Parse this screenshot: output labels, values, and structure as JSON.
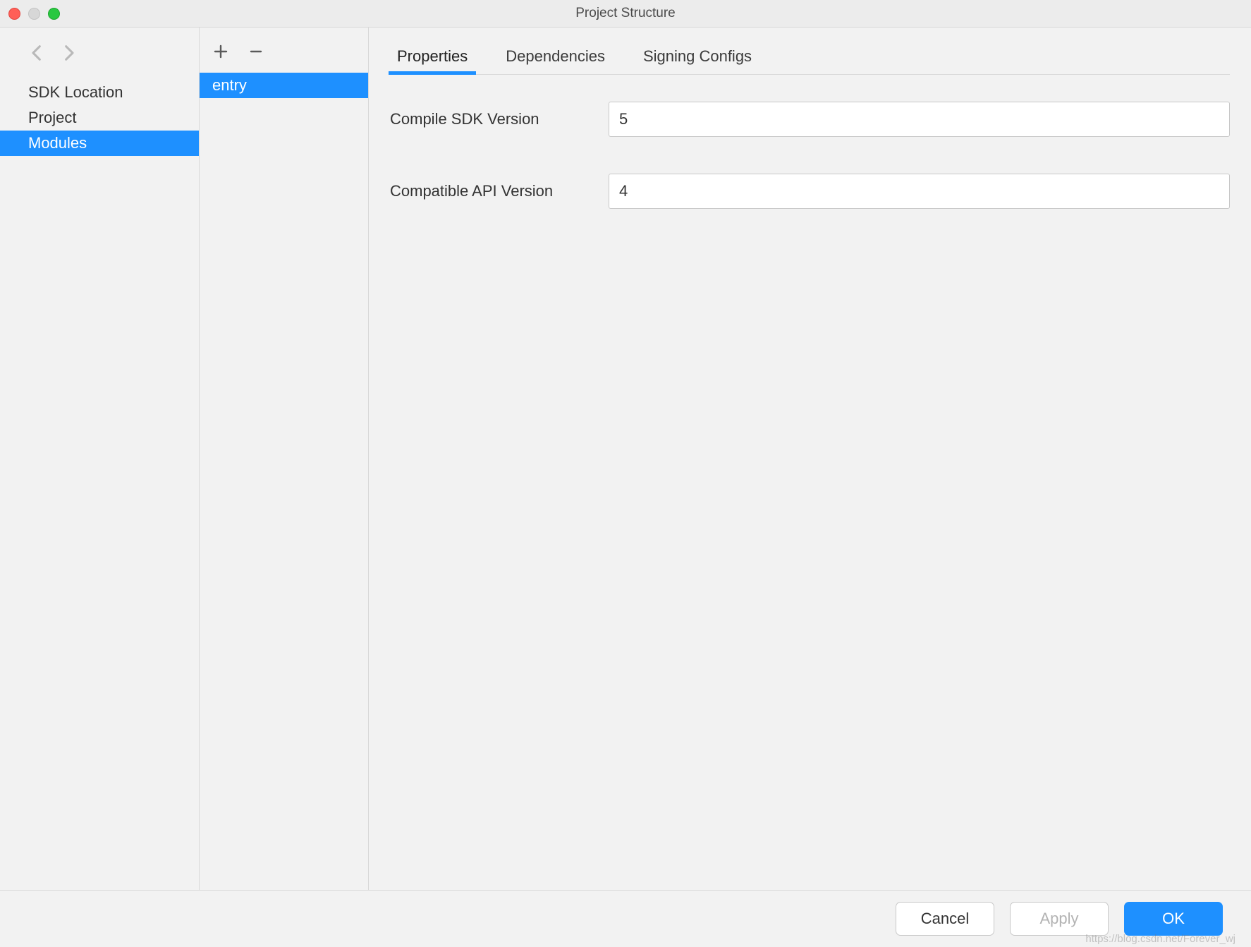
{
  "window": {
    "title": "Project Structure"
  },
  "sidebar": {
    "items": [
      {
        "label": "SDK Location",
        "selected": false
      },
      {
        "label": "Project",
        "selected": false
      },
      {
        "label": "Modules",
        "selected": true
      }
    ]
  },
  "modules": {
    "items": [
      {
        "label": "entry",
        "selected": true
      }
    ]
  },
  "tabs": [
    {
      "label": "Properties",
      "active": true
    },
    {
      "label": "Dependencies",
      "active": false
    },
    {
      "label": "Signing Configs",
      "active": false
    }
  ],
  "properties": {
    "compile_sdk_label": "Compile SDK Version",
    "compile_sdk_value": "5",
    "compatible_api_label": "Compatible API Version",
    "compatible_api_value": "4"
  },
  "footer": {
    "cancel": "Cancel",
    "apply": "Apply",
    "ok": "OK"
  },
  "watermark": "https://blog.csdn.net/Forever_wj"
}
